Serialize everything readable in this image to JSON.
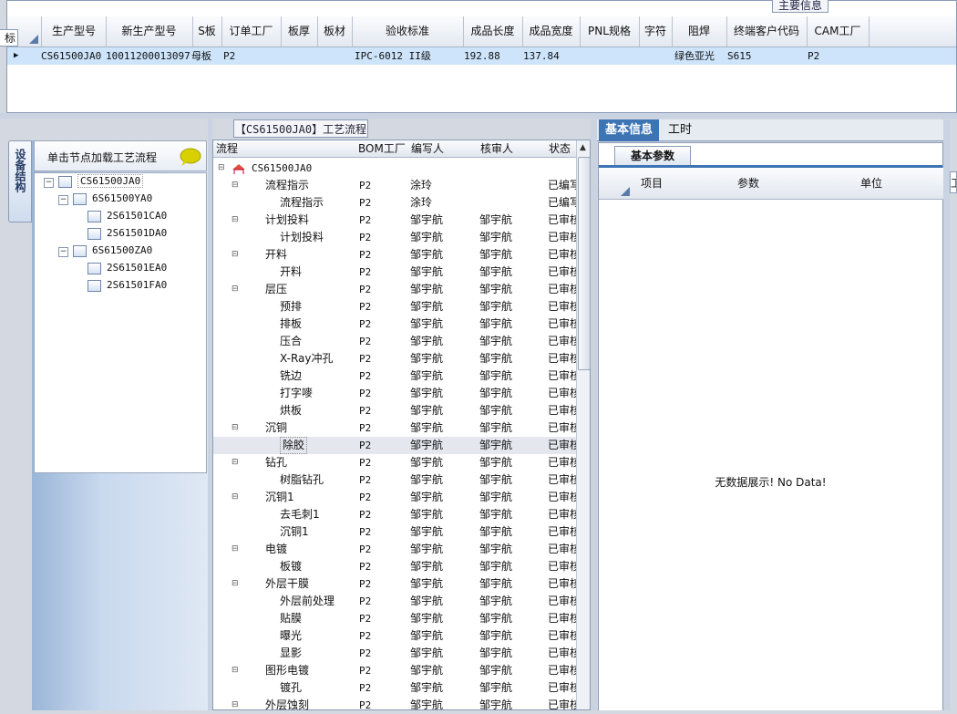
{
  "top_grid": {
    "tab_label": "主要信息",
    "side_label": "标示",
    "columns": [
      "生产型号",
      "新生产型号",
      "S板",
      "订单工厂",
      "板厚",
      "板材",
      "验收标准",
      "成品长度",
      "成品宽度",
      "PNL规格",
      "字符",
      "阻焊",
      "终端客户代码",
      "CAM工厂"
    ],
    "row": {
      "生产型号": "CS61500JA0",
      "新生产型号": "10011200013097",
      "S板": "母板",
      "订单工厂": "P2",
      "板厚": "",
      "板材": "",
      "验收标准": "IPC-6012 II级",
      "成品长度": "192.88",
      "成品宽度": "137.84",
      "PNL规格": "",
      "字符": "",
      "阻焊": "绿色亚光",
      "终端客户代码": "S615",
      "CAM工厂": "P2"
    }
  },
  "left_panel": {
    "vertical_tab": "设备结构",
    "header": "单击节点加载工艺流程",
    "tree": [
      "CS61500JA0",
      "6S61500YA0",
      "2S61501CA0",
      "2S61501DA0",
      "6S61500ZA0",
      "2S61501EA0",
      "2S61501FA0"
    ]
  },
  "process_panel": {
    "title": "【CS61500JA0】工艺流程",
    "columns": [
      "流程",
      "BOM工厂",
      "编写人",
      "核审人",
      "状态"
    ],
    "root": "CS61500JA0",
    "rows": [
      {
        "name": "流程指示",
        "type": "folder",
        "factory": "P2",
        "writer": "涂玲",
        "reviewer": "",
        "status": "已编写"
      },
      {
        "name": "流程指示",
        "type": "doc",
        "factory": "P2",
        "writer": "涂玲",
        "reviewer": "",
        "status": "已编写"
      },
      {
        "name": "计划投料",
        "type": "folder",
        "factory": "P2",
        "writer": "邹宇航",
        "reviewer": "邹宇航",
        "status": "已审核"
      },
      {
        "name": "计划投料",
        "type": "doc",
        "factory": "P2",
        "writer": "邹宇航",
        "reviewer": "邹宇航",
        "status": "已审核"
      },
      {
        "name": "开料",
        "type": "folder",
        "factory": "P2",
        "writer": "邹宇航",
        "reviewer": "邹宇航",
        "status": "已审核"
      },
      {
        "name": "开料",
        "type": "doc",
        "factory": "P2",
        "writer": "邹宇航",
        "reviewer": "邹宇航",
        "status": "已审核"
      },
      {
        "name": "层压",
        "type": "folder",
        "factory": "P2",
        "writer": "邹宇航",
        "reviewer": "邹宇航",
        "status": "已审核"
      },
      {
        "name": "预排",
        "type": "doc",
        "factory": "P2",
        "writer": "邹宇航",
        "reviewer": "邹宇航",
        "status": "已审核"
      },
      {
        "name": "排板",
        "type": "doc",
        "factory": "P2",
        "writer": "邹宇航",
        "reviewer": "邹宇航",
        "status": "已审核"
      },
      {
        "name": "压合",
        "type": "doc",
        "factory": "P2",
        "writer": "邹宇航",
        "reviewer": "邹宇航",
        "status": "已审核"
      },
      {
        "name": "X-Ray冲孔",
        "type": "doc",
        "factory": "P2",
        "writer": "邹宇航",
        "reviewer": "邹宇航",
        "status": "已审核"
      },
      {
        "name": "铣边",
        "type": "doc",
        "factory": "P2",
        "writer": "邹宇航",
        "reviewer": "邹宇航",
        "status": "已审核"
      },
      {
        "name": "打字嘜",
        "type": "doc",
        "factory": "P2",
        "writer": "邹宇航",
        "reviewer": "邹宇航",
        "status": "已审核"
      },
      {
        "name": "烘板",
        "type": "doc",
        "factory": "P2",
        "writer": "邹宇航",
        "reviewer": "邹宇航",
        "status": "已审核"
      },
      {
        "name": "沉铜",
        "type": "folder",
        "factory": "P2",
        "writer": "邹宇航",
        "reviewer": "邹宇航",
        "status": "已审核"
      },
      {
        "name": "除胶",
        "type": "doc",
        "factory": "P2",
        "writer": "邹宇航",
        "reviewer": "邹宇航",
        "status": "已审核",
        "selected": true
      },
      {
        "name": "钻孔",
        "type": "folder",
        "factory": "P2",
        "writer": "邹宇航",
        "reviewer": "邹宇航",
        "status": "已审核"
      },
      {
        "name": "树脂钻孔",
        "type": "doc",
        "factory": "P2",
        "writer": "邹宇航",
        "reviewer": "邹宇航",
        "status": "已审核"
      },
      {
        "name": "沉铜1",
        "type": "folder",
        "factory": "P2",
        "writer": "邹宇航",
        "reviewer": "邹宇航",
        "status": "已审核"
      },
      {
        "name": "去毛刺1",
        "type": "doc",
        "factory": "P2",
        "writer": "邹宇航",
        "reviewer": "邹宇航",
        "status": "已审核"
      },
      {
        "name": "沉铜1",
        "type": "doc",
        "factory": "P2",
        "writer": "邹宇航",
        "reviewer": "邹宇航",
        "status": "已审核"
      },
      {
        "name": "电镀",
        "type": "folder",
        "factory": "P2",
        "writer": "邹宇航",
        "reviewer": "邹宇航",
        "status": "已审核"
      },
      {
        "name": "板镀",
        "type": "doc",
        "factory": "P2",
        "writer": "邹宇航",
        "reviewer": "邹宇航",
        "status": "已审核"
      },
      {
        "name": "外层干膜",
        "type": "folder",
        "factory": "P2",
        "writer": "邹宇航",
        "reviewer": "邹宇航",
        "status": "已审核"
      },
      {
        "name": "外层前处理",
        "type": "doc",
        "factory": "P2",
        "writer": "邹宇航",
        "reviewer": "邹宇航",
        "status": "已审核"
      },
      {
        "name": "贴膜",
        "type": "doc",
        "factory": "P2",
        "writer": "邹宇航",
        "reviewer": "邹宇航",
        "status": "已审核"
      },
      {
        "name": "曝光",
        "type": "doc",
        "factory": "P2",
        "writer": "邹宇航",
        "reviewer": "邹宇航",
        "status": "已审核"
      },
      {
        "name": "显影",
        "type": "doc",
        "factory": "P2",
        "writer": "邹宇航",
        "reviewer": "邹宇航",
        "status": "已审核"
      },
      {
        "name": "图形电镀",
        "type": "folder",
        "factory": "P2",
        "writer": "邹宇航",
        "reviewer": "邹宇航",
        "status": "已审核"
      },
      {
        "name": "镀孔",
        "type": "doc",
        "factory": "P2",
        "writer": "邹宇航",
        "reviewer": "邹宇航",
        "status": "已审核"
      },
      {
        "name": "外层蚀刻",
        "type": "folder",
        "factory": "P2",
        "writer": "邹宇航",
        "reviewer": "邹宇航",
        "status": "已审核"
      }
    ]
  },
  "right_panel": {
    "tabs": [
      "基本信息",
      "工时"
    ],
    "subtab": "基本参数",
    "columns": [
      "项目",
      "参数",
      "单位"
    ],
    "empty_text": "无数据展示! No Data!",
    "side_label": "工"
  },
  "colors": {
    "accent": "#2f6fb8",
    "selected_row": "#cde4fb",
    "tab_active": "#3d74b4"
  }
}
